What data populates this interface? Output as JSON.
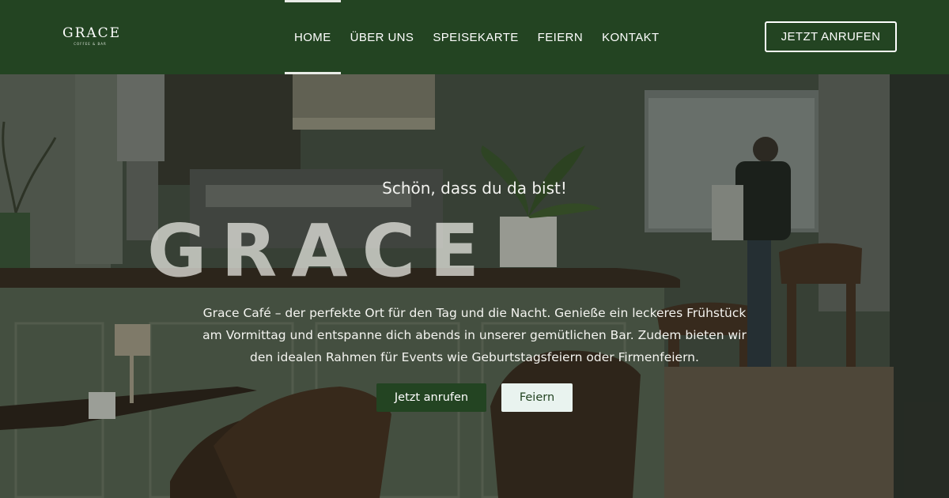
{
  "logo": {
    "name": "GRACE",
    "sub": "COFFEE & BAR"
  },
  "nav": {
    "items": [
      {
        "label": "HOME",
        "active": true
      },
      {
        "label": "ÜBER UNS",
        "active": false
      },
      {
        "label": "SPEISEKARTE",
        "active": false
      },
      {
        "label": "FEIERN",
        "active": false
      },
      {
        "label": "KONTAKT",
        "active": false
      }
    ],
    "cta_label": "JETZT ANRUFEN"
  },
  "hero": {
    "tagline": "Schön, dass du da bist!",
    "title": "GRACE",
    "text": "Grace Café – der perfekte Ort für den Tag und die Nacht. Genieße ein leckeres Frühstück am Vormittag und entspanne dich abends in unserer gemütlichen Bar. Zudem bieten wir den idealen Rahmen für Events wie Geburtstagsfeiern oder Firmenfeiern.",
    "primary_button": "Jetzt anrufen",
    "secondary_button": "Feiern"
  },
  "colors": {
    "header_bg": "#234422",
    "primary_button_bg": "#234422",
    "secondary_button_bg": "#e9f3ef"
  }
}
